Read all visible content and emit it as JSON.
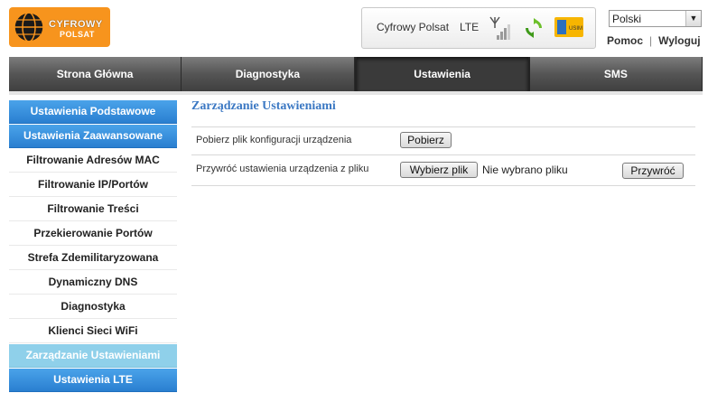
{
  "header": {
    "logo_text_line1": "CYFROWY",
    "logo_text_line2": "POLSAT",
    "operator": "Cyfrowy Polsat",
    "network": "LTE",
    "sim_label": "USIM",
    "language": "Polski",
    "help_link": "Pomoc",
    "logout_link": "Wyloguj",
    "link_separator": "|"
  },
  "nav": {
    "tabs": [
      {
        "label": "Strona Główna"
      },
      {
        "label": "Diagnostyka"
      },
      {
        "label": "Ustawienia"
      },
      {
        "label": "SMS"
      }
    ]
  },
  "sidebar": {
    "items": [
      {
        "label": "Ustawienia Podstawowe"
      },
      {
        "label": "Ustawienia Zaawansowane"
      },
      {
        "label": "Filtrowanie Adresów MAC"
      },
      {
        "label": "Filtrowanie IP/Portów"
      },
      {
        "label": "Filtrowanie Treści"
      },
      {
        "label": "Przekierowanie Portów"
      },
      {
        "label": "Strefa Zdemilitaryzowana"
      },
      {
        "label": "Dynamiczny DNS"
      },
      {
        "label": "Diagnostyka"
      },
      {
        "label": "Klienci Sieci WiFi"
      },
      {
        "label": "Zarządzanie Ustawieniami"
      },
      {
        "label": "Ustawienia LTE"
      }
    ]
  },
  "main": {
    "title": "Zarządzanie Ustawieniami",
    "download_label": "Pobierz plik konfiguracji urządzenia",
    "download_button": "Pobierz",
    "restore_label": "Przywróć ustawienia urządzenia z pliku",
    "choose_file_button": "Wybierz plik",
    "no_file_text": "Nie wybrano pliku",
    "restore_button": "Przywróć"
  },
  "colors": {
    "accent_blue": "#3b78c3",
    "brand_orange": "#f7941d",
    "sidebar_blue": "#2a7fd0",
    "sidebar_current": "#8fd0ea"
  }
}
